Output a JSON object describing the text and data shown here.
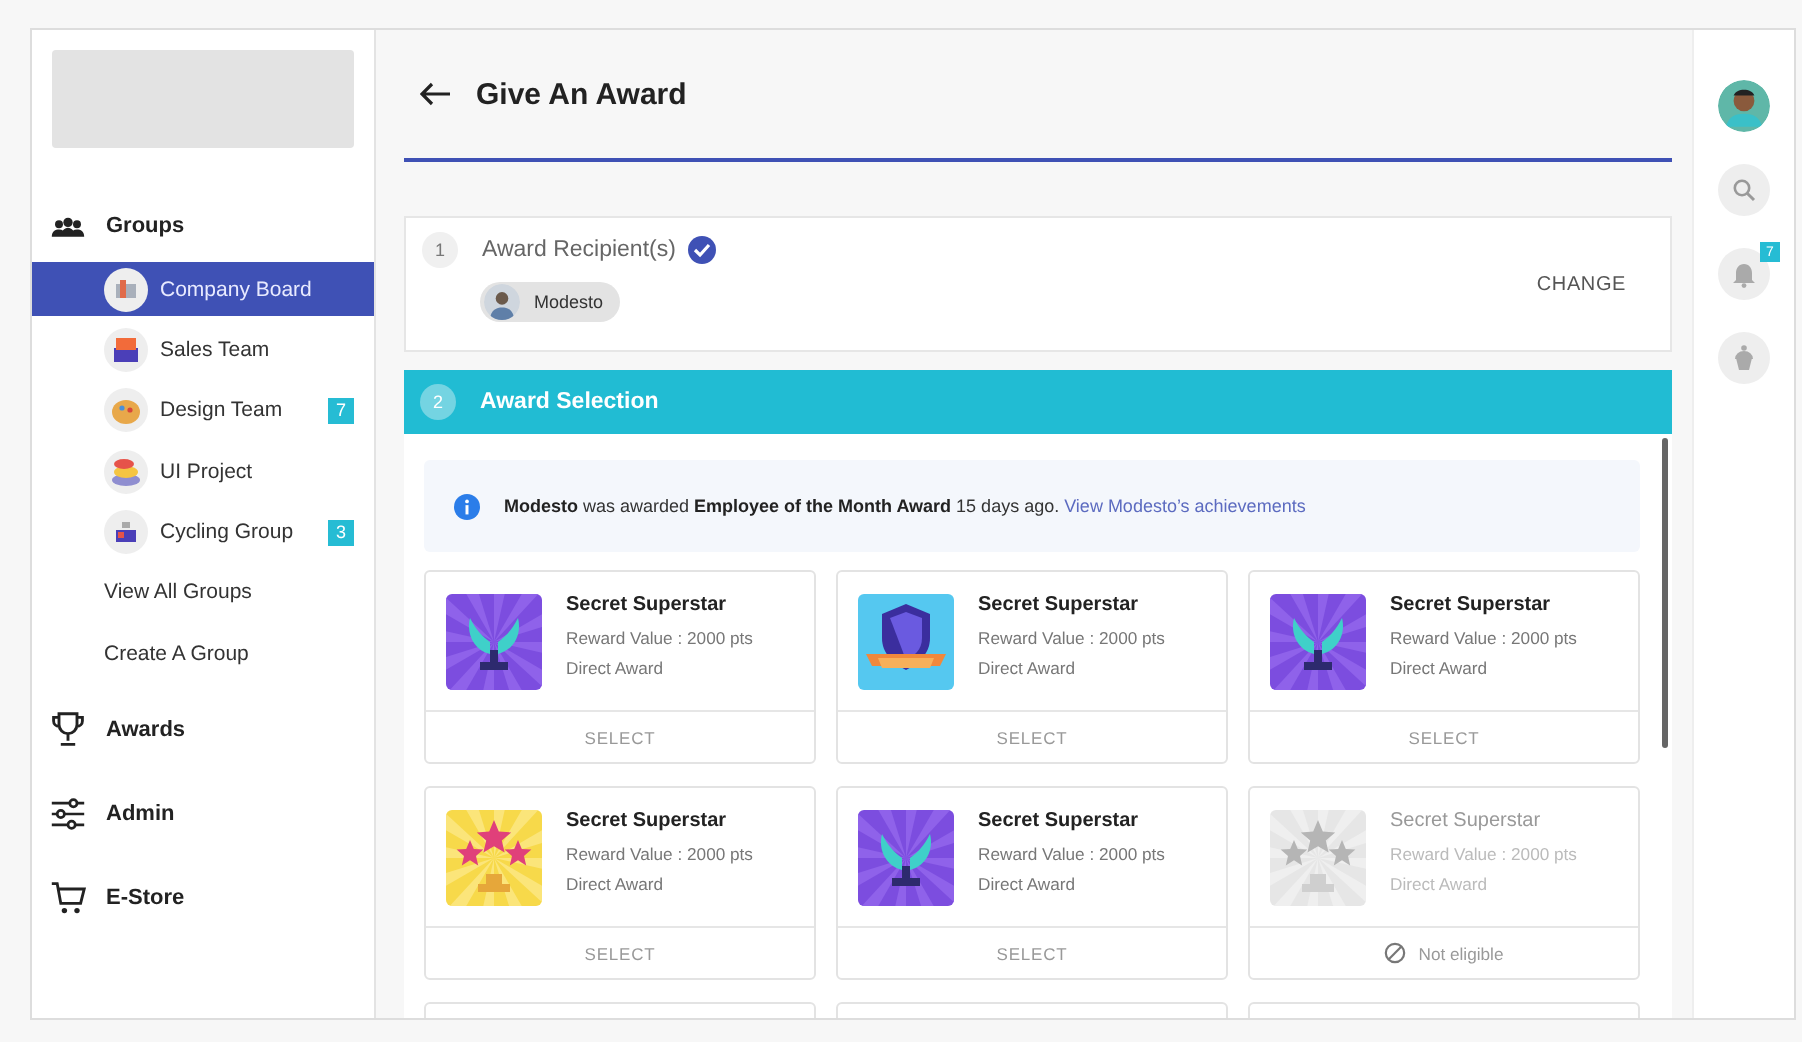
{
  "sidebar": {
    "sections": [
      {
        "label": "Groups",
        "items": [
          {
            "label": "Company Board",
            "kind": "group",
            "selected": true
          },
          {
            "label": "Sales Team",
            "kind": "group",
            "selected": false
          },
          {
            "label": "Design Team",
            "kind": "group",
            "selected": false,
            "badge": "7"
          },
          {
            "label": "UI Project",
            "kind": "group",
            "selected": false
          },
          {
            "label": "Cycling Group",
            "kind": "group",
            "selected": false,
            "badge": "3"
          },
          {
            "label": "View All Groups",
            "kind": "link",
            "selected": false
          },
          {
            "label": "Create A Group",
            "kind": "link",
            "selected": false
          }
        ]
      },
      {
        "label": "Awards"
      },
      {
        "label": "Admin"
      },
      {
        "label": "E-Store"
      }
    ]
  },
  "header": {
    "title": "Give An Award"
  },
  "steps": [
    {
      "number": "1",
      "title": "Award Recipient(s)",
      "active": false,
      "done": true,
      "recipients": [
        {
          "name": "Modesto"
        }
      ],
      "action": "CHANGE"
    },
    {
      "number": "2",
      "title": "Award Selection",
      "active": true,
      "done": false
    }
  ],
  "notice": {
    "text": "**Modesto** was awarded **Employee of the Month Award** 15 days ago.",
    "link": "View Modesto’s achievements"
  },
  "awards": [
    {
      "kind": "award",
      "title": "Secret Superstar",
      "value": "Reward Value : 2000 pts",
      "type": "Direct Award",
      "eligible": true,
      "action": "SELECT"
    },
    {
      "kind": "award",
      "title": "Secret Superstar",
      "value": "Reward Value : 2000 pts",
      "type": "Direct Award",
      "eligible": true,
      "action": "SELECT"
    },
    {
      "kind": "award",
      "title": "Secret Superstar",
      "value": "Reward Value : 2000 pts",
      "type": "Direct Award",
      "eligible": true,
      "action": "SELECT"
    },
    {
      "kind": "award",
      "title": "Secret Superstar",
      "value": "Reward Value : 2000 pts",
      "type": "Direct Award",
      "eligible": true,
      "action": "SELECT"
    },
    {
      "kind": "award",
      "title": "Secret Superstar",
      "value": "Reward Value : 2000 pts",
      "type": "Direct Award",
      "eligible": true,
      "action": "SELECT"
    },
    {
      "kind": "award",
      "title": "Secret Superstar",
      "value": "Reward Value : 2000 pts",
      "type": "Direct Award",
      "eligible": false,
      "action": "Not eligible"
    },
    {
      "kind": "cut"
    },
    {
      "kind": "cut"
    },
    {
      "kind": "cut"
    }
  ],
  "rail": {
    "notification_badge": "7"
  }
}
